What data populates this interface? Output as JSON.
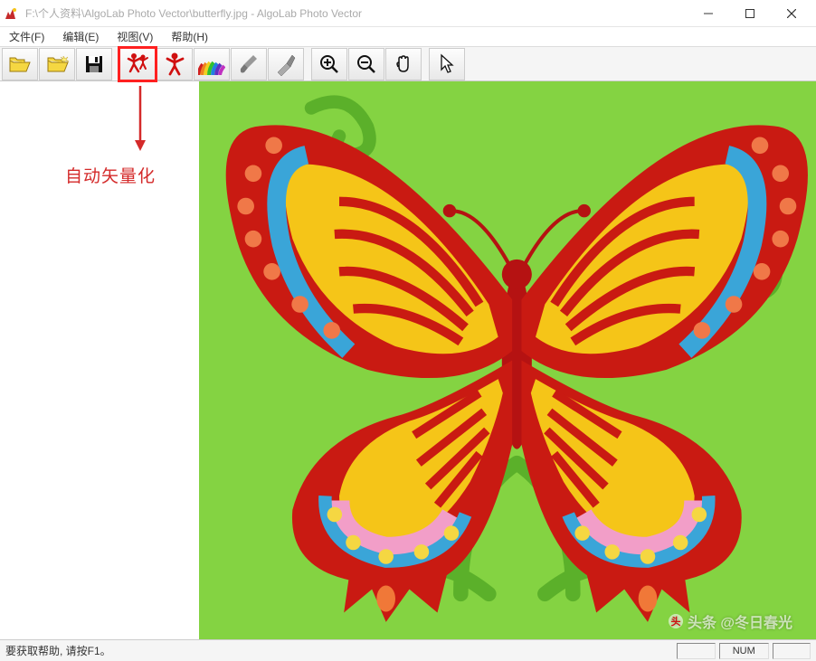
{
  "titlebar": {
    "title": "F:\\个人资料\\AlgoLab Photo Vector\\butterfly.jpg - AlgoLab Photo Vector"
  },
  "menu": {
    "file": "文件(F)",
    "edit": "编辑(E)",
    "view": "视图(V)",
    "help": "帮助(H)"
  },
  "toolbar": {
    "open": "open",
    "new": "new",
    "save": "save",
    "autovector": "auto-vectorize",
    "vectorize": "vectorize",
    "colors": "colors",
    "brush": "brush",
    "knife": "knife",
    "zoomin": "zoom-in",
    "zoomout": "zoom-out",
    "pan": "pan",
    "pointer": "pointer"
  },
  "annotation": {
    "label": "自动矢量化"
  },
  "statusbar": {
    "help": "要获取帮助, 请按F1。",
    "num": "NUM"
  },
  "watermark": {
    "text": "头条 @冬日春光"
  }
}
